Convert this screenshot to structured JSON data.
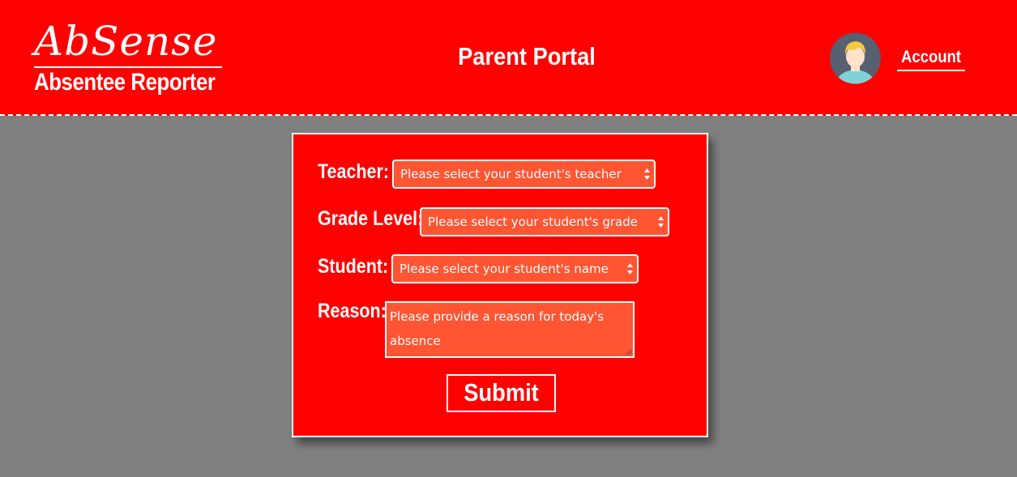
{
  "header": {
    "logo_text": "AbSense",
    "subtitle": "Absentee Reporter",
    "page_title": "Parent Portal",
    "account_label": "Account",
    "avatar_icon": "user-avatar-icon"
  },
  "form": {
    "teacher": {
      "label": "Teacher:",
      "placeholder": "Please select your student's teacher"
    },
    "grade": {
      "label": "Grade Level:",
      "placeholder": "Please select your student's grade"
    },
    "student": {
      "label": "Student:",
      "placeholder": "Please select your student's name"
    },
    "reason": {
      "label": "Reason:",
      "placeholder": "Please provide a reason for today's absence"
    },
    "submit_label": "Submit"
  },
  "colors": {
    "brand_red": "#ff0000",
    "field_orange": "#ff5533",
    "background_gray": "#808080",
    "text_white": "#ffffff"
  }
}
